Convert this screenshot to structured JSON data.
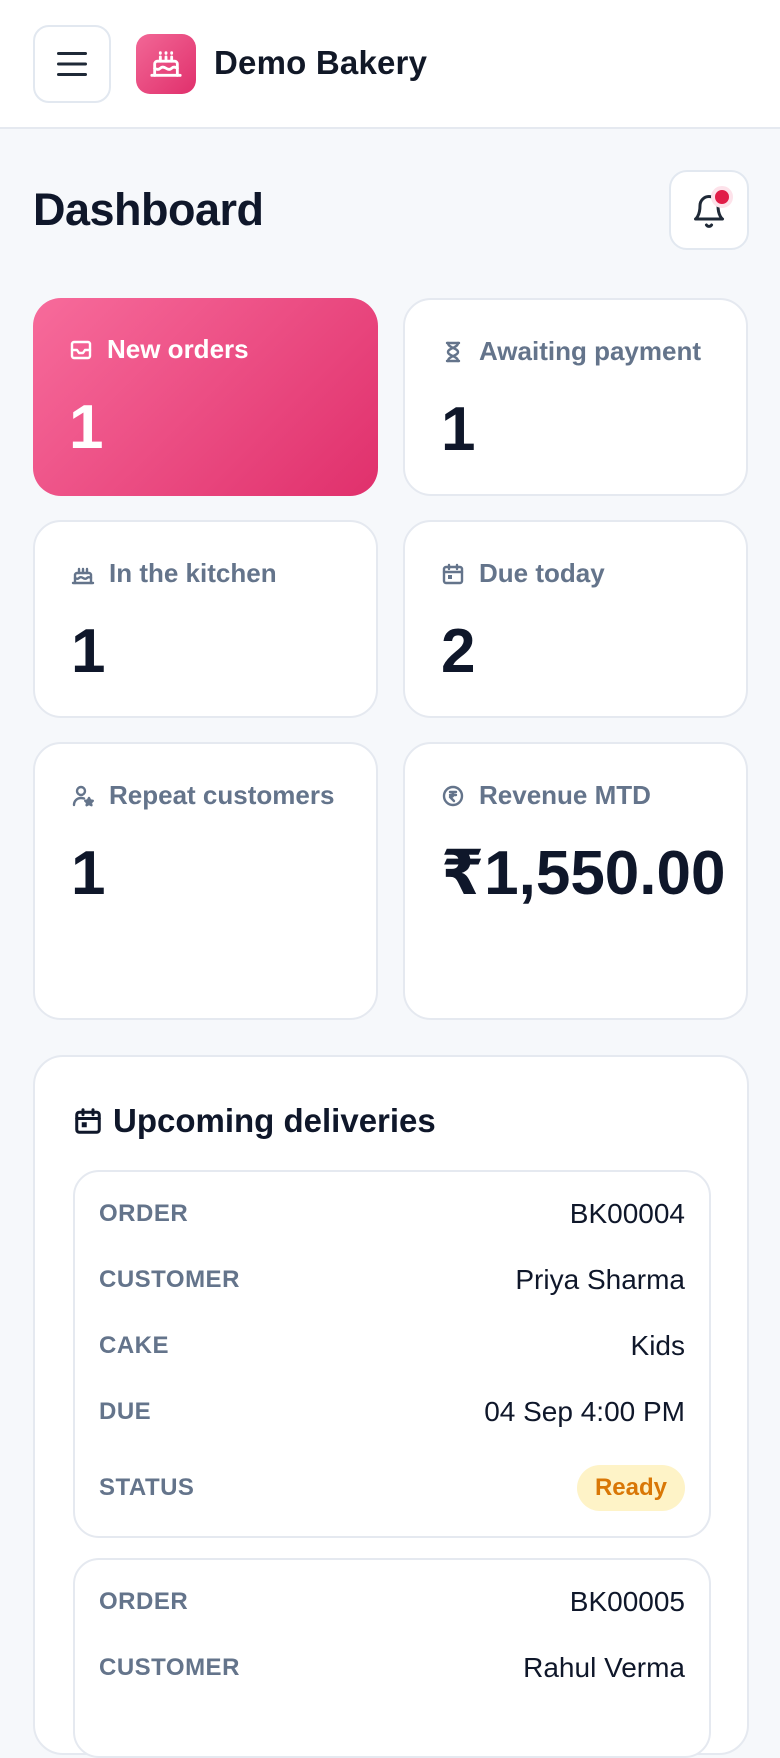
{
  "header": {
    "brand_name": "Demo Bakery"
  },
  "page": {
    "title": "Dashboard"
  },
  "stats": [
    {
      "label": "New orders",
      "value": "1",
      "icon": "inbox-icon"
    },
    {
      "label": "Awaiting payment",
      "value": "1",
      "icon": "hourglass-icon"
    },
    {
      "label": "In the kitchen",
      "value": "1",
      "icon": "cake-icon"
    },
    {
      "label": "Due today",
      "value": "2",
      "icon": "calendar-icon"
    },
    {
      "label": "Repeat customers",
      "value": "1",
      "icon": "user-star-icon"
    },
    {
      "label": "Revenue MTD",
      "value": "₹1,550.00",
      "icon": "rupee-icon"
    }
  ],
  "deliveries": {
    "title": "Upcoming deliveries",
    "labels": {
      "order": "ORDER",
      "customer": "CUSTOMER",
      "cake": "CAKE",
      "due": "DUE",
      "status": "STATUS"
    },
    "items": [
      {
        "order": "BK00004",
        "customer": "Priya Sharma",
        "cake": "Kids",
        "due": "04 Sep 4:00 PM",
        "status": "Ready"
      },
      {
        "order": "BK00005",
        "customer": "Rahul Verma"
      }
    ]
  },
  "colors": {
    "accent": "#e0306c",
    "status_ready_bg": "#fef3c7",
    "status_ready_text": "#d97706"
  }
}
